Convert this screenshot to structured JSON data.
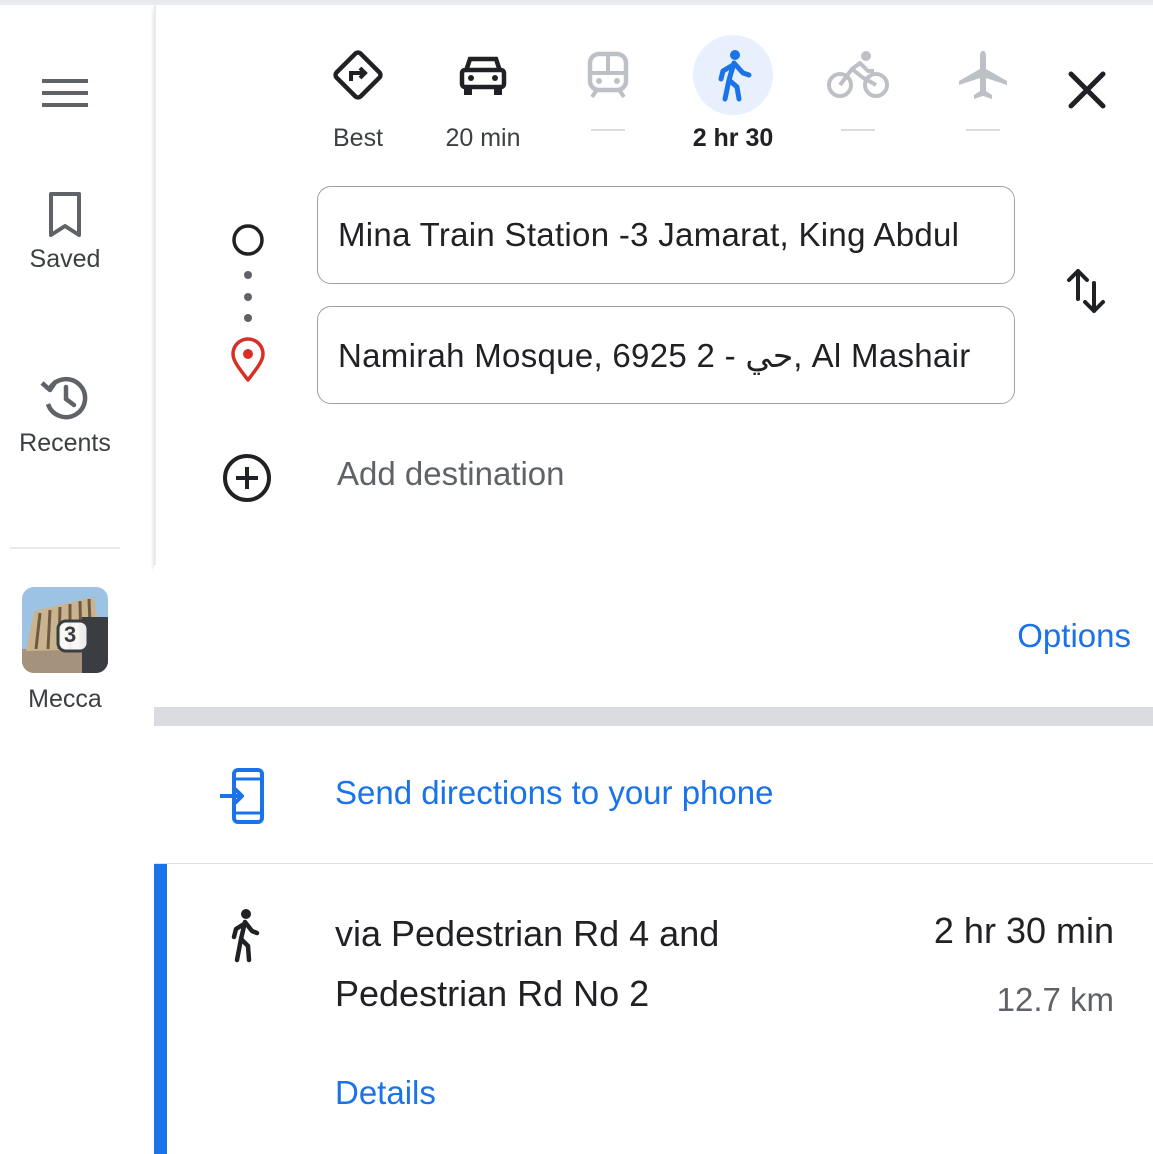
{
  "sidebar": {
    "saved_label": "Saved",
    "recents_label": "Recents",
    "recent_place": {
      "label": "Mecca",
      "badge": "3"
    }
  },
  "modes": [
    {
      "name": "best",
      "label": "Best",
      "active": false,
      "icon": "directions-icon"
    },
    {
      "name": "driving",
      "label": "20 min",
      "active": false,
      "icon": "car-icon"
    },
    {
      "name": "transit",
      "label": "",
      "active": false,
      "icon": "train-icon"
    },
    {
      "name": "walking",
      "label": "2 hr 30",
      "active": true,
      "icon": "walk-icon"
    },
    {
      "name": "cycling",
      "label": "",
      "active": false,
      "icon": "bike-icon"
    },
    {
      "name": "flights",
      "label": "",
      "active": false,
      "icon": "plane-icon"
    }
  ],
  "origin": {
    "value": "Mina Train Station -3 Jamarat, King Abdul"
  },
  "destination": {
    "value": "Namirah Mosque, 6925 2 - حي, Al Mashair"
  },
  "add_destination": "Add destination",
  "options_label": "Options",
  "send_directions_label": "Send directions to your phone",
  "route": {
    "title": "via Pedestrian Rd 4 and Pedestrian Rd No 2",
    "duration": "2 hr 30 min",
    "distance": "12.7 km",
    "details_label": "Details"
  },
  "colors": {
    "accent": "#1a73e8",
    "active_mode_bg": "#e8f0fe",
    "destination_pin": "#d93025",
    "muted_icon": "#bdc1c6"
  }
}
